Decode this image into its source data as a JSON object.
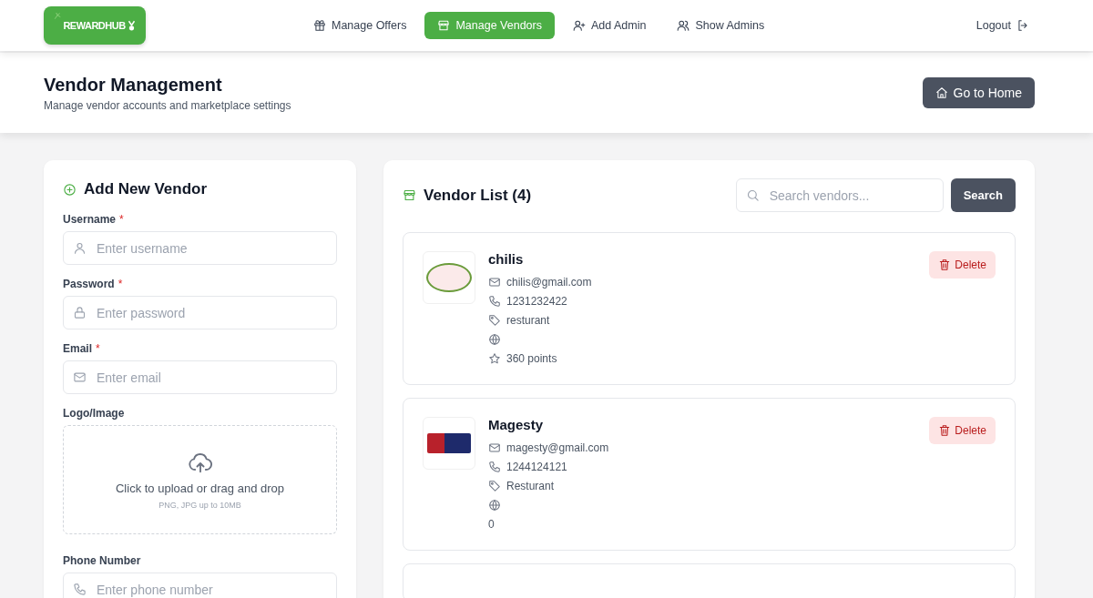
{
  "brand": {
    "name": "REWARDHUB"
  },
  "nav": [
    {
      "kind": "offers",
      "label": "Manage Offers",
      "selected": false
    },
    {
      "kind": "vendors",
      "label": "Manage Vendors",
      "selected": true
    },
    {
      "kind": "add-admin",
      "label": "Add Admin",
      "selected": false
    },
    {
      "kind": "admins",
      "label": "Show Admins",
      "selected": false
    }
  ],
  "logout": {
    "label": "Logout"
  },
  "header": {
    "title": "Vendor Management",
    "subtitle": "Manage vendor accounts and marketplace settings",
    "home_button": "Go to Home"
  },
  "form": {
    "title": "Add New Vendor",
    "fields": [
      {
        "kind": "username",
        "label": "Username",
        "required_mark": "*",
        "placeholder": "Enter username"
      },
      {
        "kind": "password",
        "label": "Password",
        "required_mark": "*",
        "placeholder": "Enter password"
      },
      {
        "kind": "email",
        "label": "Email",
        "required_mark": "*",
        "placeholder": "Enter email"
      },
      {
        "kind": "upload",
        "label": "Logo/Image",
        "prompt": "Click to upload or drag and drop",
        "hint": "PNG, JPG up to 10MB"
      },
      {
        "kind": "phone",
        "label": "Phone Number",
        "placeholder": "Enter phone number"
      }
    ]
  },
  "vendor_list": {
    "title": "Vendor List (4)",
    "search_placeholder": "Search vendors...",
    "search_button": "Search",
    "vendors": [
      {
        "name": "chilis",
        "delete": "Delete",
        "details": [
          {
            "kind": "email",
            "text": "chilis@gmail.com"
          },
          {
            "kind": "phone",
            "text": "1231232422"
          },
          {
            "kind": "category",
            "text": "resturant"
          },
          {
            "kind": "website"
          },
          {
            "kind": "points",
            "text": "360 points"
          }
        ]
      },
      {
        "name": "Magesty",
        "delete": "Delete",
        "details": [
          {
            "kind": "email",
            "text": "magesty@gmail.com"
          },
          {
            "kind": "phone",
            "text": "1244124121"
          },
          {
            "kind": "category",
            "text": "Resturant"
          },
          {
            "kind": "website"
          },
          {
            "kind": "plain",
            "text": "0"
          }
        ]
      },
      {
        "kind": "cut"
      }
    ]
  }
}
